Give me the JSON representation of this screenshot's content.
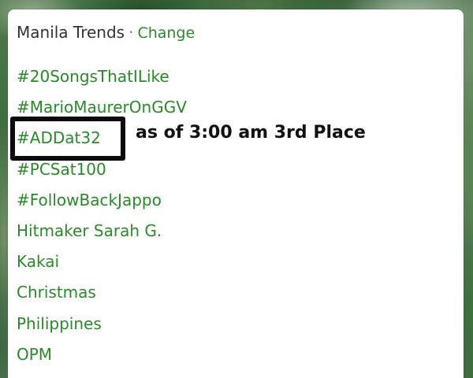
{
  "header": {
    "title": "Manila Trends",
    "separator": "·",
    "change_label": "Change"
  },
  "trends": [
    "#20SongsThatILike",
    "#MarioMaurerOnGGV",
    "#ADDat32",
    "#PCSat100",
    "#FollowBackJappo",
    "Hitmaker Sarah G.",
    "Kakai",
    "Christmas",
    "Philippines",
    "OPM"
  ],
  "annotation": {
    "text": "as of 3:00 am 3rd Place"
  },
  "colors": {
    "link_green": "#2a8a2a",
    "header_text": "#333333",
    "panel_bg": "#ffffff",
    "annotation_box": "#0b0b0b"
  }
}
